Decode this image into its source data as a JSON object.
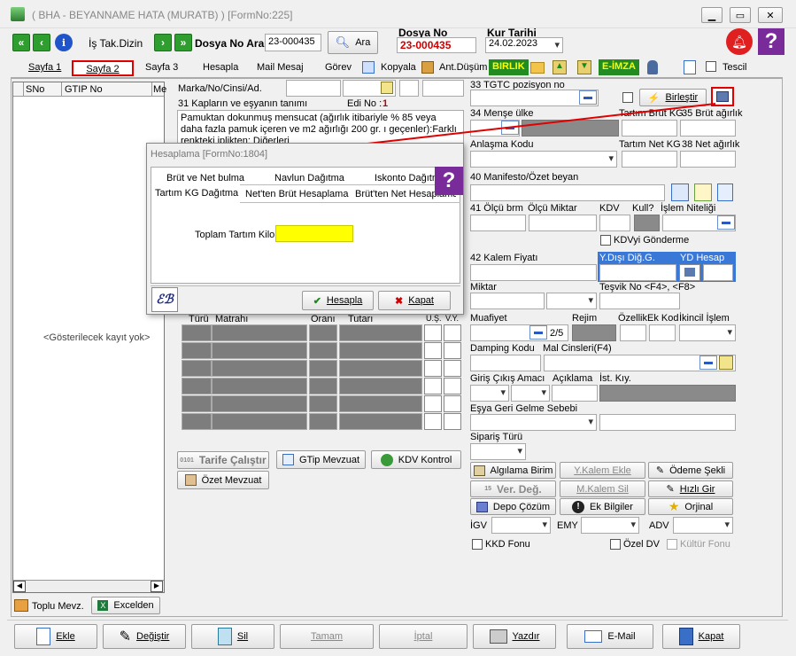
{
  "window": {
    "title": "( BHA - BEYANNAME HATA (MURATB) ) [FormNo:225]",
    "controls": [
      "minimize",
      "maximize",
      "close"
    ]
  },
  "toolbar": {
    "is_takip": "İş Tak.Dizin",
    "dosya_no_ara_label": "Dosya No Ara",
    "search_value": "23-000435",
    "ara_label": "Ara",
    "dosya_no_label": "Dosya No",
    "dosya_no_value": "23-000435",
    "kur_tarihi_label": "Kur Tarihi",
    "kur_tarihi_value": "24.02.2023"
  },
  "tabs": [
    {
      "label": "Sayfa 1"
    },
    {
      "label": "Sayfa 2"
    },
    {
      "label": "Sayfa 3"
    },
    {
      "label": "Hesapla"
    },
    {
      "label": "Mail Mesaj"
    },
    {
      "label": "Görev"
    },
    {
      "label": "Kopyala"
    },
    {
      "label": "Ant.Düşüm"
    },
    {
      "label": "BIRLIK"
    },
    {
      "label": "E-İMZA"
    },
    {
      "label": "Tescil"
    }
  ],
  "left_grid": {
    "columns": [
      "SNo",
      "GTIP No",
      "Me"
    ],
    "empty_text": "<Gösterilecek kayıt yok>",
    "toplu_mevz": "Toplu Mevz.",
    "excelden": "Excelden"
  },
  "middle": {
    "marka_label": "Marka/No/Cinsi/Ad.",
    "kaplar_label": "31 Kapların ve eşyanın tanımı",
    "edi_no_label": "Edi No :",
    "edi_no_value": "1",
    "description": "Pamuktan dokunmuş mensucat (ağırlık itibariyle % 85 veya daha fazla pamuk içeren ve m2 ağırlığı 200 gr. ı geçenler):Farklı renkteki iplikten: Diğerleri",
    "grid_headers": [
      "Türü",
      "Matrahı",
      "Oranı",
      "Tutarı",
      "Ü.Ş.",
      "V.Y."
    ],
    "tarife_calistir": "Tarife Çalıştır",
    "gtip_mevzuat": "GTip Mevzuat",
    "kdv_kontrol": "KDV Kontrol",
    "ozet_mevzuat": "Özet Mevzuat"
  },
  "right": {
    "tgtc_label": "33 TGTC pozisyon no",
    "birlestir": "Birleştir",
    "mense_label": "34 Menşe ülke",
    "tartim_brut": "Tartım Brüt KG",
    "brut_agirlik": "35 Brüt ağırlık",
    "anlasma_kodu": "Anlaşma Kodu",
    "tartim_net": "Tartım Net KG",
    "net_agirlik": "38 Net ağırlık",
    "manifesto": "40 Manifesto/Özet beyan",
    "olcu_brm": "41 Ölçü brm",
    "olcu_miktar": "Ölçü Miktar",
    "kdv": "KDV",
    "kull": "Kull?",
    "islem_niteligi": "İşlem Niteliği",
    "kdvyi_gonderme": "KDVyi Gönderme",
    "kalem_fiyati": "42 Kalem Fiyatı",
    "ydisi_dig": "Y.Dışı Diğ.G.",
    "yd_hesap": "YD Hesap",
    "miktar": "Miktar",
    "tesvik_no": "Teşvik No <F4>, <F8>",
    "muafiyet": "Muafiyet",
    "muafiyet_count": "2/5",
    "rejim": "Rejim",
    "ozellik": "Özellik",
    "ek_kod": "Ek Kod",
    "ikincil_islem": "İkincil İşlem",
    "damping_kodu": "Damping Kodu",
    "mal_cinsleri": "Mal Cinsleri(F4)",
    "giris_cikis": "Giriş Çıkış Amacı",
    "aciklama": "Açıklama",
    "ist_kiy": "İst. Kıy.",
    "esya_geri": "Eşya Geri Gelme Sebebi",
    "siparis_turu": "Sipariş Türü",
    "buttons": {
      "algilama": "Algılama Birim",
      "y_kalem_ekle": "Y.Kalem Ekle",
      "odeme_sekli": "Ödeme Şekli",
      "ver_deg": "Ver. Değ.",
      "m_kalem_sil": "M.Kalem Sil",
      "hizli_gir": "Hızlı Gir",
      "depo_cozum": "Depo Çözüm",
      "ek_bilgiler": "Ek Bilgiler",
      "orjinal": "Orjinal"
    },
    "igv": "İGV",
    "emy": "EMY",
    "adv": "ADV",
    "kkd_fonu": "KKD Fonu",
    "ozel_dv": "Özel DV",
    "kultur_fonu": "Kültür Fonu"
  },
  "dialog": {
    "title": "Hesaplama [FormNo:1804]",
    "tabs_row1": [
      "Brüt ve Net bulma",
      "Navlun Dağıtma",
      "Iskonto Dağıtma"
    ],
    "tabs_row2": [
      "Tartım KG Dağıtma",
      "Net'ten Brüt Hesaplama",
      "Brüt'ten Net Hesaplama"
    ],
    "field_label": "Toplam Tartım Kilo",
    "field_value": "",
    "hesapla": "Hesapla",
    "kapat": "Kapat"
  },
  "bottom": {
    "ekle": "Ekle",
    "degistir": "Değiştir",
    "sil": "Sil",
    "tamam": "Tamam",
    "iptal": "İptal",
    "yazdir": "Yazdır",
    "email": "E-Mail",
    "kapat": "Kapat"
  },
  "colors": {
    "accent_red": "#e00000",
    "help_purple": "#7a2b9a",
    "yellow_field": "#ffff00",
    "selection_blue": "#3a78d8",
    "grid_gray": "#7d7d7d"
  }
}
